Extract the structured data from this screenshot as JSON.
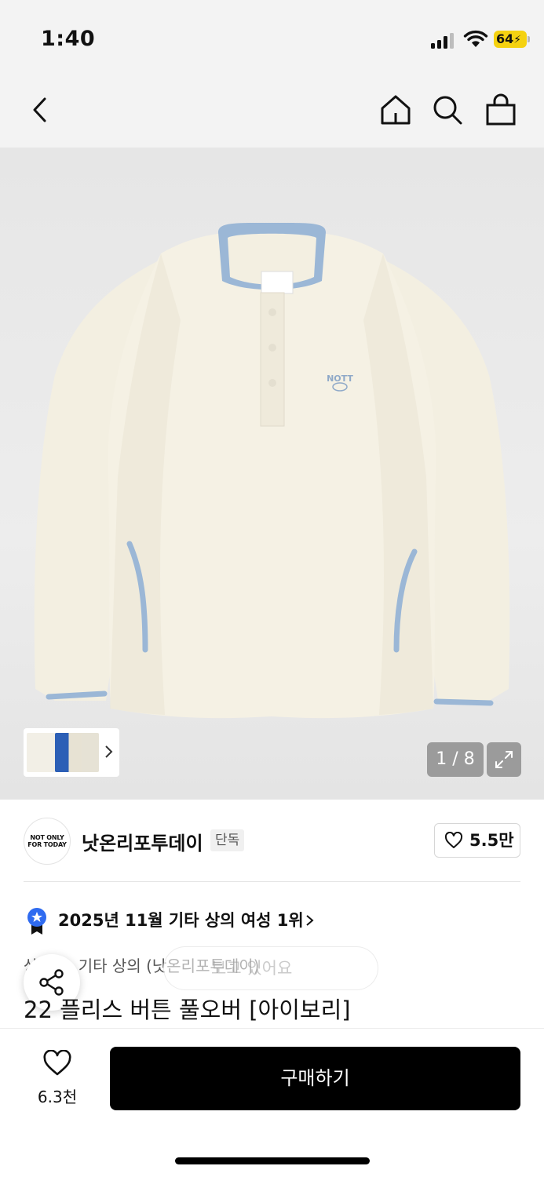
{
  "status_bar": {
    "time": "1:40",
    "battery": "64"
  },
  "nav": {
    "back_icon": "chevron-left-icon",
    "home_icon": "home-icon",
    "search_icon": "search-icon",
    "cart_icon": "shopping-bag-icon"
  },
  "gallery": {
    "counter": "1 / 8",
    "current_index": 1,
    "total": 8,
    "garment_label_text": "NOTT",
    "thumbnail_count": 3
  },
  "brand": {
    "logo_text_line1": "NOT ONLY",
    "logo_text_line2": "FOR TODAY",
    "name": "낫온리포투데이",
    "badge": "단독",
    "likes": "5.5만"
  },
  "ranking": {
    "text": "2025년 11월 기타 상의 여성 1위"
  },
  "product": {
    "category": "상의 > 기타 상의 (낫온리포투데이)",
    "category_visible": "기타 상의 (낫온리포투데이)",
    "title": "22 플리스 버튼 풀오버 [아이보리]",
    "toast_text": "보고 있어요"
  },
  "bottom": {
    "wish_count": "6.3천",
    "buy_label": "구매하기"
  },
  "colors": {
    "accent_blue": "#2f6bf0",
    "buy_button": "#000000",
    "battery": "#f5d211",
    "garment_body": "#f4f0e2",
    "garment_trim": "#9bb7d6"
  }
}
